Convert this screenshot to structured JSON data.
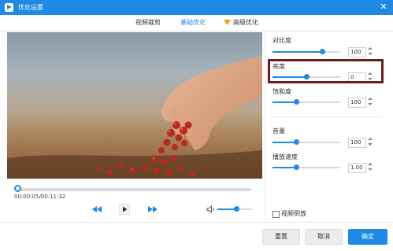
{
  "window": {
    "title": "优化设置",
    "close_glyph": "✕",
    "accent": "#1f8ae6"
  },
  "tabs": [
    {
      "label": "视频裁剪",
      "active": false
    },
    {
      "label": "基础优化",
      "active": true
    },
    {
      "label": "高级优化",
      "active": false,
      "badge": "vip-icon"
    }
  ],
  "player": {
    "timecode": "00:00:05/00:11:32",
    "progress": 0.0,
    "volume": 0.55
  },
  "panel": {
    "contrast": {
      "label": "对比度",
      "value": "100",
      "level": 0.74
    },
    "brightness": {
      "label": "亮度",
      "value": "0",
      "level": 0.5
    },
    "saturation": {
      "label": "饱和度",
      "value": "100",
      "level": 0.35
    },
    "volume": {
      "label": "音量",
      "value": "100",
      "level": 0.35
    },
    "speed": {
      "label": "播放速度",
      "value": "1.00",
      "level": 0.35
    },
    "reverse_label": "视频倒放",
    "highlight_color": "#6b1d1d"
  },
  "footer": {
    "reset": "重置",
    "cancel": "取消",
    "ok": "确定"
  }
}
